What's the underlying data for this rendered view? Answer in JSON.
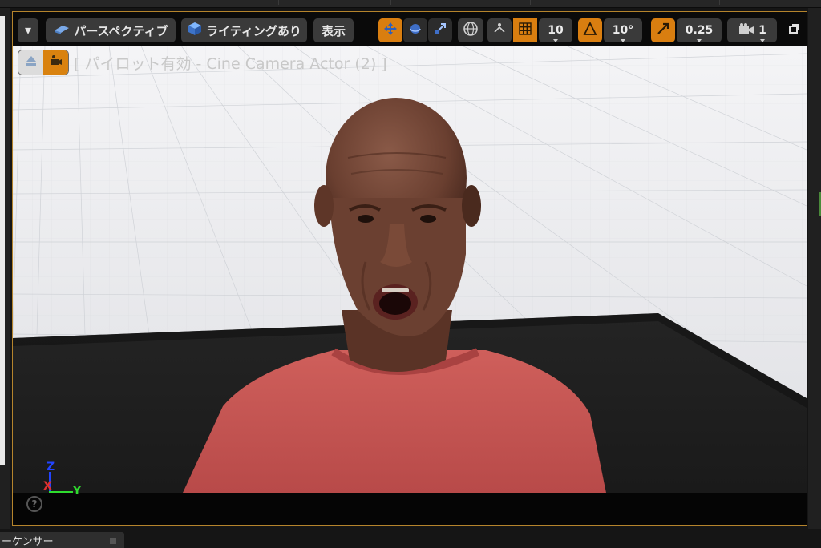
{
  "toolbar": {
    "menu_arrow": "▾",
    "perspective_label": "パースペクティブ",
    "lighting_label": "ライティングあり",
    "show_label": "表示",
    "grid_snap_value": "10",
    "rotation_snap_value": "10°",
    "scale_snap_value": "0.25",
    "camera_speed_value": "1"
  },
  "viewport": {
    "pilot_label": "[ パイロット有効 - Cine Camera Actor (2) ]",
    "axis": {
      "z": "Z",
      "x": "X",
      "y": "Y"
    },
    "help": "?"
  },
  "bottom_tab": {
    "label": "ーケンサー"
  },
  "icons": {
    "perspective": "perspective-cube-icon",
    "lighting": "lit-cube-icon",
    "translate": "translate-arrows-icon",
    "rotate": "rotate-sphere-icon",
    "scale": "scale-arrows-icon",
    "world": "globe-icon",
    "surface_snap": "surface-snap-icon",
    "grid": "grid-icon",
    "rotation_snap": "angle-icon",
    "scale_snap": "scale-snap-icon",
    "camera_speed": "camera-icon",
    "maximize": "maximize-icon",
    "eject": "eject-icon",
    "pilot": "pilot-camera-icon"
  },
  "colors": {
    "accent_orange": "#d97e10",
    "viewport_border": "#b5842c",
    "axis_x": "#e03030",
    "axis_y": "#2edc2e",
    "axis_z": "#2244ff",
    "sweater": "#c95754"
  }
}
